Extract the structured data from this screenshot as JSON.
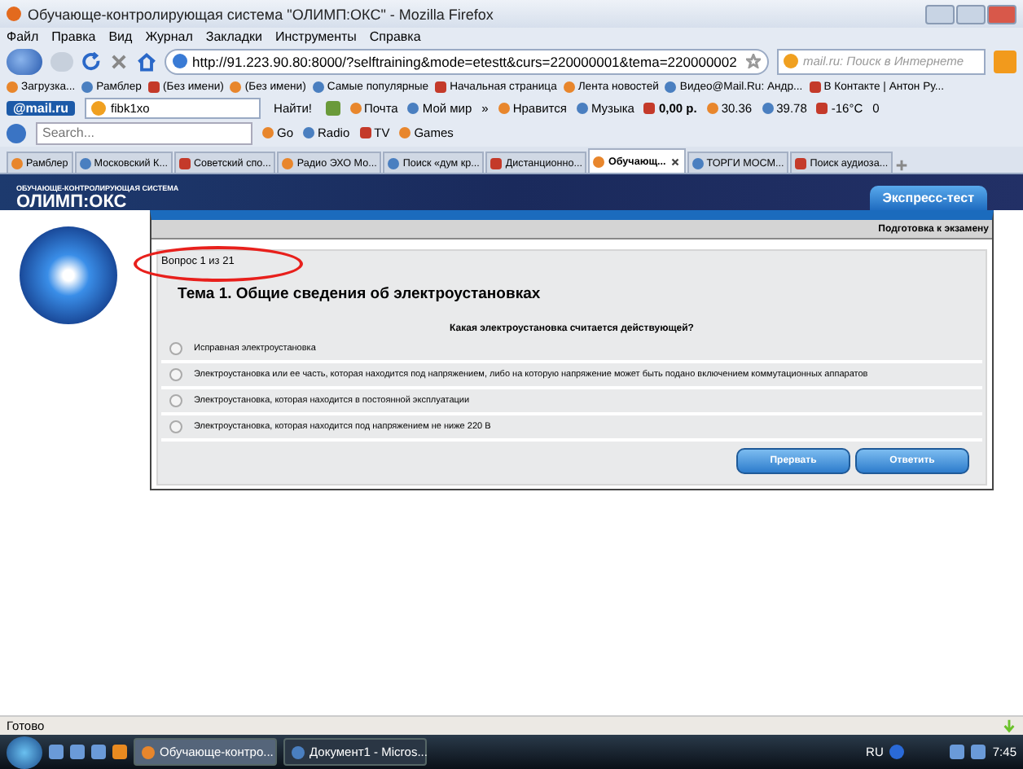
{
  "window": {
    "title": "Обучающе-контролирующая система \"ОЛИМП:ОКС\" - Mozilla Firefox"
  },
  "menu": [
    "Файл",
    "Правка",
    "Вид",
    "Журнал",
    "Закладки",
    "Инструменты",
    "Справка"
  ],
  "nav": {
    "url": "http://91.223.90.80:8000/?selftraining&mode=etestt&curs=220000001&tema=220000002",
    "search_placeholder": "mail.ru: Поиск в Интернете"
  },
  "bookmarks": [
    "Загрузка...",
    "Рамблер",
    "(Без имени)",
    "(Без имени)",
    "Самые популярные",
    "Начальная страница",
    "Лента новостей",
    "Видео@Mail.Ru: Андр...",
    "В Контакте | Антон Ру..."
  ],
  "mail_toolbar": {
    "logo": "@mail.ru",
    "field_value": "fibk1xo",
    "find": "Найти!",
    "items": [
      "Почта",
      "Мой мир",
      "»",
      "Нравится",
      "Музыка",
      "0,00 р.",
      "30.36",
      "39.78",
      "-16°C",
      "0"
    ]
  },
  "search_toolbar": {
    "placeholder": "Search...",
    "items": [
      "Go",
      "Radio",
      "TV",
      "Games"
    ]
  },
  "tabs": [
    {
      "label": "Рамблер",
      "selected": false
    },
    {
      "label": "Московский К...",
      "selected": false
    },
    {
      "label": "Советский спо...",
      "selected": false
    },
    {
      "label": "Радио ЭХО Мо...",
      "selected": false
    },
    {
      "label": "Поиск «дум кр...",
      "selected": false
    },
    {
      "label": "Дистанционно...",
      "selected": false
    },
    {
      "label": "Обучающ...",
      "selected": true
    },
    {
      "label": "ТОРГИ МОСМ...",
      "selected": false
    },
    {
      "label": "Поиск аудиоза...",
      "selected": false
    }
  ],
  "page": {
    "logo_caption": "ОБУЧАЮЩЕ-КОНТРОЛИРУЮЩАЯ СИСТЕМА",
    "logo_title": "ОЛИМП:ОКС",
    "express_tab": "Экспресс-тест",
    "subheader": "Подготовка к экзамену",
    "counter": "Вопрос 1 из 21",
    "topic": "Тема 1. Общие сведения об электроустановках",
    "question": "Какая электроустановка считается действующей?",
    "answers": [
      {
        "text": "Исправная электроустановка",
        "selected": false
      },
      {
        "text": "Электроустановка или ее часть, которая находится под напряжением, либо на которую напряжение может быть подано включением коммутационных аппаратов",
        "selected": false
      },
      {
        "text": "Электроустановка, которая находится в постоянной эксплуатации",
        "selected": false
      },
      {
        "text": "Электроустановка, которая находится под напряжением не ниже 220 В",
        "selected": false
      }
    ],
    "buttons": [
      "Прервать",
      "Ответить"
    ]
  },
  "status_bar": "Готово",
  "taskbar": {
    "tasks": [
      {
        "label": "Обучающе-контро...",
        "selected": true
      },
      {
        "label": "Документ1 - Micros...",
        "selected": false
      }
    ],
    "language": "RU",
    "clock": "7:45"
  }
}
